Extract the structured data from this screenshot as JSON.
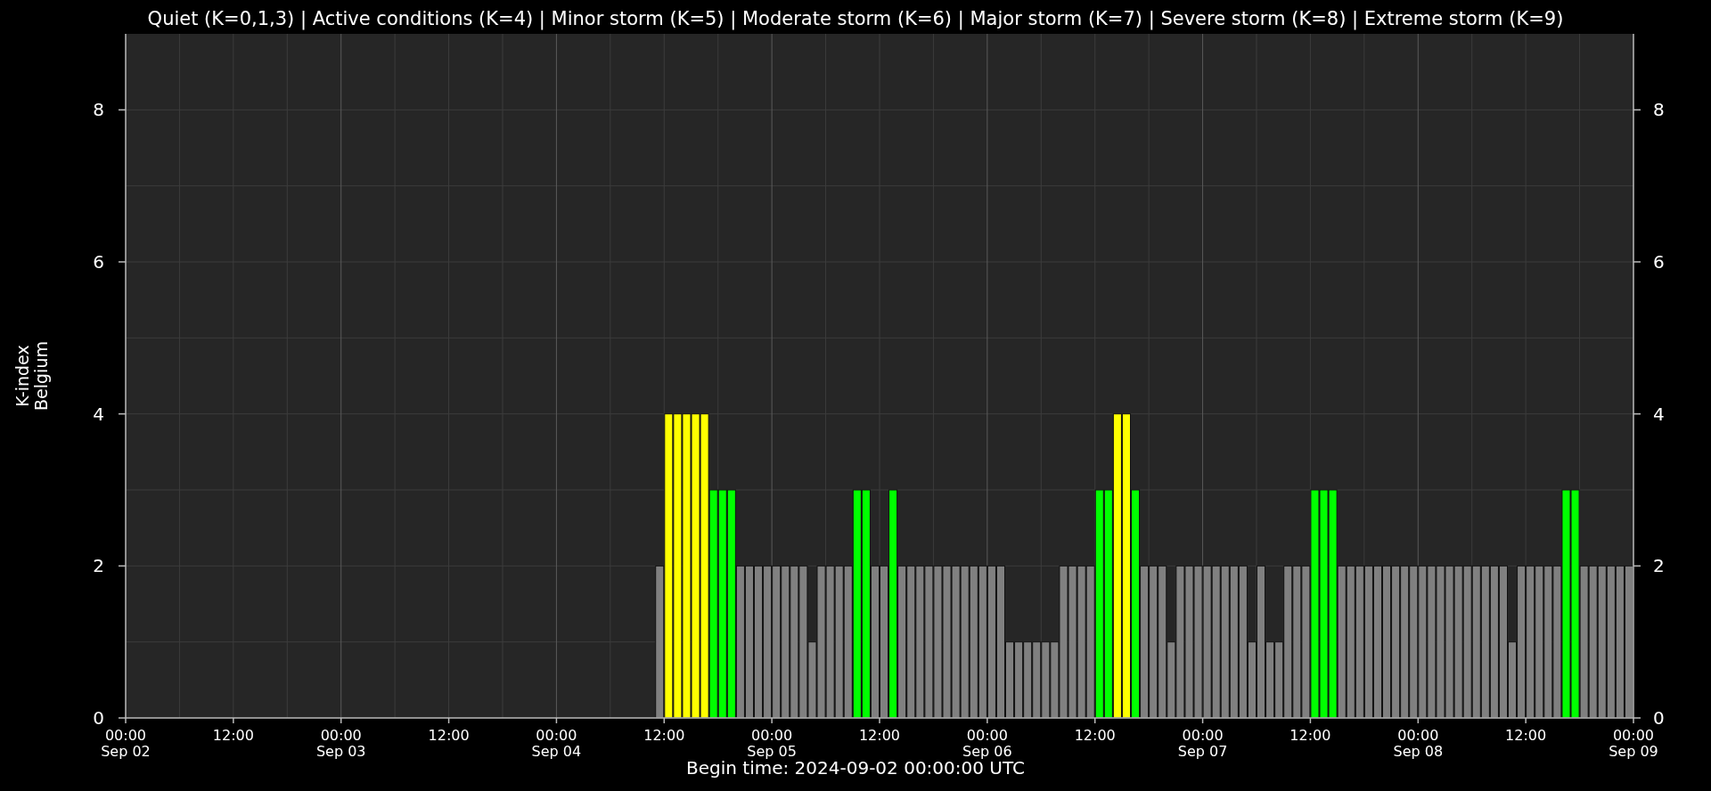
{
  "chart_data": {
    "type": "bar",
    "title": "Quiet (K=0,1,3) | Active conditions (K=4) | Minor storm (K=5) | Moderate storm (K=6) | Major storm (K=7) | Severe storm (K=8) | Extreme storm (K=9)",
    "xlabel": "Begin time: 2024-09-02 00:00:00 UTC",
    "ylabel": "K-index\nBelgium",
    "ylim": [
      0,
      9
    ],
    "yticks": [
      0,
      2,
      4,
      6,
      8
    ],
    "y2ticks": [
      0,
      2,
      4,
      6,
      8
    ],
    "y2lim": [
      0,
      9
    ],
    "grid": true,
    "categories": [
      "00:00\nSep 02",
      null,
      null,
      null,
      null,
      null,
      null,
      null,
      null,
      null,
      null,
      null,
      "12:00",
      null,
      null,
      null,
      null,
      null,
      null,
      null,
      null,
      null,
      null,
      null,
      "00:00\nSep 03",
      null,
      null,
      null,
      null,
      null,
      null,
      null,
      null,
      null,
      null,
      null,
      "12:00",
      null,
      null,
      null,
      null,
      null,
      null,
      null,
      null,
      null,
      null,
      null,
      "00:00\nSep 04",
      null,
      null,
      null,
      null,
      null,
      null,
      null,
      null,
      null,
      null,
      null,
      "12:00",
      null,
      null,
      null,
      null,
      null,
      null,
      null,
      null,
      null,
      null,
      null,
      "00:00\nSep 05",
      null,
      null,
      null,
      null,
      null,
      null,
      null,
      null,
      null,
      null,
      null,
      "12:00",
      null,
      null,
      null,
      null,
      null,
      null,
      null,
      null,
      null,
      null,
      null,
      "00:00\nSep 06",
      null,
      null,
      null,
      null,
      null,
      null,
      null,
      null,
      null,
      null,
      null,
      "12:00",
      null,
      null,
      null,
      null,
      null,
      null,
      null,
      null,
      null,
      null,
      null,
      "00:00\nSep 07",
      null,
      null,
      null,
      null,
      null,
      null,
      null,
      null,
      null,
      null,
      null,
      "12:00",
      null,
      null,
      null,
      null,
      null,
      null,
      null,
      null,
      null,
      null,
      null,
      "00:00\nSep 08",
      null,
      null,
      null,
      null,
      null,
      null,
      null,
      null,
      null,
      null,
      null,
      "12:00",
      null,
      null,
      null,
      null,
      null,
      null,
      null,
      null,
      null,
      null,
      null,
      "00:00\nSep 09"
    ],
    "series": [
      {
        "values": [
          0,
          0,
          0,
          0,
          0,
          0,
          0,
          0,
          0,
          0,
          0,
          0,
          0,
          0,
          0,
          0,
          0,
          0,
          0,
          0,
          0,
          0,
          0,
          0,
          0,
          0,
          0,
          0,
          0,
          0,
          0,
          0,
          0,
          0,
          0,
          0,
          0,
          0,
          0,
          0,
          0,
          0,
          0,
          0,
          0,
          0,
          0,
          0,
          0,
          0,
          0,
          0,
          0,
          0,
          0,
          0,
          0,
          0,
          0,
          2,
          4,
          4,
          4,
          4,
          4,
          3,
          3,
          3,
          2,
          2,
          2,
          2,
          2,
          2,
          2,
          2,
          1,
          2,
          2,
          2,
          2,
          3,
          3,
          2,
          2,
          3,
          2,
          2,
          2,
          2,
          2,
          2,
          2,
          2,
          2,
          2,
          2,
          2,
          1,
          1,
          1,
          1,
          1,
          1,
          2,
          2,
          2,
          2,
          3,
          3,
          4,
          4,
          3,
          2,
          2,
          2,
          1,
          2,
          2,
          2,
          2,
          2,
          2,
          2,
          2,
          1,
          2,
          1,
          1,
          2,
          2,
          2,
          3,
          3,
          3,
          2,
          2,
          2,
          2,
          2,
          2,
          2,
          2,
          2,
          2,
          2,
          2,
          2,
          2,
          2,
          2,
          2,
          2,
          2,
          1,
          2,
          2,
          2,
          2,
          2,
          3,
          3,
          2,
          2,
          2,
          2,
          2,
          2,
          null
        ]
      }
    ]
  }
}
